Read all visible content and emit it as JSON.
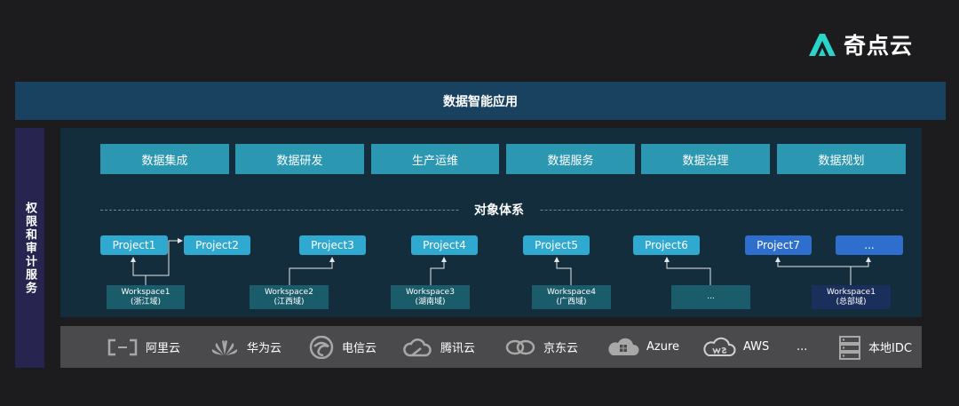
{
  "logo": {
    "text": "奇点云"
  },
  "app_bar": {
    "title": "数据智能应用"
  },
  "left_bar": {
    "title": "权限和审计服务"
  },
  "capabilities": [
    "数据集成",
    "数据研发",
    "生产运维",
    "数据服务",
    "数据治理",
    "数据规划"
  ],
  "object_system": {
    "title": "对象体系"
  },
  "projects": [
    "Project1",
    "Project2",
    "Project3",
    "Project4",
    "Project5",
    "Project6",
    "Project7",
    "..."
  ],
  "workspaces": [
    {
      "name": "Workspace1",
      "region": "(浙江域)"
    },
    {
      "name": "Workspace2",
      "region": "(江西域)"
    },
    {
      "name": "Workspace3",
      "region": "(湖南域)"
    },
    {
      "name": "Workspace4",
      "region": "(广西域)"
    },
    {
      "name": "...",
      "region": ""
    },
    {
      "name": "Workspace1",
      "region": "(总部域)"
    }
  ],
  "clouds": [
    {
      "label": "阿里云",
      "icon": "aliyun-icon"
    },
    {
      "label": "华为云",
      "icon": "huawei-icon"
    },
    {
      "label": "电信云",
      "icon": "telecom-icon"
    },
    {
      "label": "腾讯云",
      "icon": "tencent-icon"
    },
    {
      "label": "京东云",
      "icon": "jdcloud-icon"
    },
    {
      "label": "Azure",
      "icon": "azure-icon"
    },
    {
      "label": "AWS",
      "icon": "aws-icon"
    },
    {
      "label": "...",
      "icon": ""
    },
    {
      "label": "本地IDC",
      "icon": "server-icon"
    }
  ],
  "colors": {
    "background": "#1c1b1d",
    "app_bar": "#184260",
    "left_bar": "#272550",
    "panel": "#132d3d",
    "capability": "#2b97b0",
    "project": "#30a9d0",
    "project_hq": "#2e6ecd",
    "workspace": "#1b5c6b",
    "workspace_hq": "#1a2f5c",
    "cloud_bar": "#4a4a4c",
    "logo_accent": "#2ad4c8"
  }
}
